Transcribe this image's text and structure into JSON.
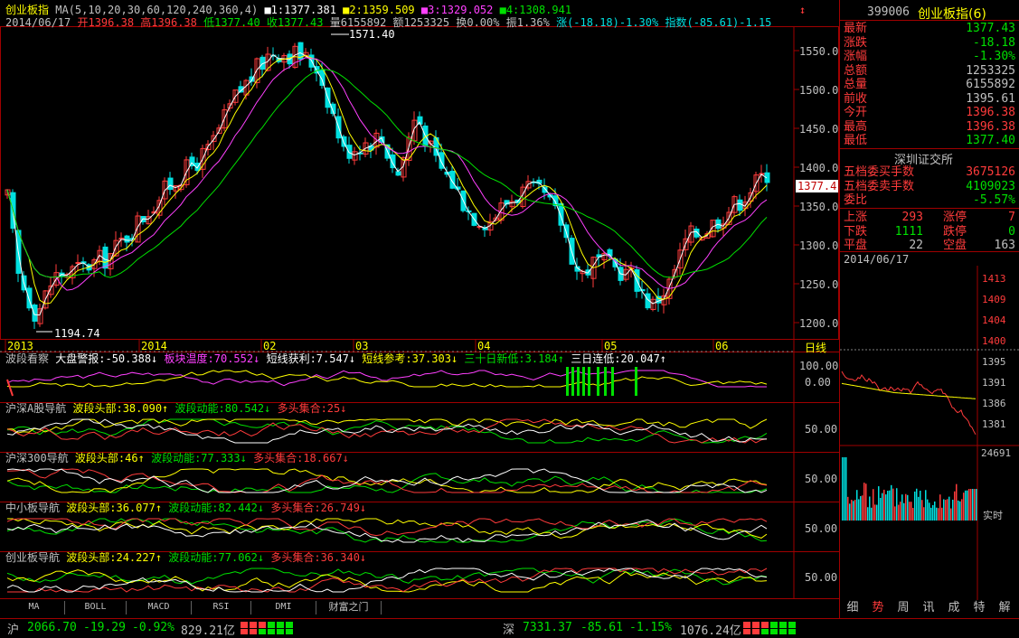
{
  "chart_header": {
    "name": "创业板指",
    "ma_label": "MA(5,10,20,30,60,120,240,360,4)",
    "ma_values": [
      {
        "label": "■1:1377.381",
        "color": "#ffffff"
      },
      {
        "label": "■2:1359.509",
        "color": "#ffff00"
      },
      {
        "label": "■3:1329.052",
        "color": "#ff40ff"
      },
      {
        "label": "■4:1308.941",
        "color": "#00e000"
      }
    ]
  },
  "day_info": {
    "date": "2014/06/17",
    "open": "开1396.38",
    "high": "高1396.38",
    "low": "低1377.40",
    "close": "收1377.43",
    "volume": "量6155892",
    "amount": "额1253325",
    "turnover": "换0.00%",
    "amplitude": "振1.36%",
    "change": "涨(-18.18)-1.30%",
    "index": "指数(-85.61)-1.15"
  },
  "price_axis": {
    "ticks": [
      "1550.0",
      "1500.0",
      "1450.0",
      "1400.0",
      "1350.0",
      "1300.0",
      "1250.0",
      "1200.0"
    ],
    "current_tag": "1377.4",
    "max_label": "1571.40",
    "min_label": "1194.74"
  },
  "time_axis": {
    "labels": [
      "2013",
      "2014",
      "02",
      "03",
      "04",
      "05",
      "06"
    ],
    "period": "日线"
  },
  "indicators": [
    {
      "name": "波段看察",
      "items": [
        {
          "text": "大盘警报:-50.388↓",
          "color": "#ffffff"
        },
        {
          "text": "板块温度:70.552↓",
          "color": "#ff40ff"
        },
        {
          "text": "短线获利:7.547↓",
          "color": "#ffffff"
        },
        {
          "text": "短线参考:37.303↓",
          "color": "#ffff00"
        },
        {
          "text": "三十日新低:3.184↑",
          "color": "#00e000"
        },
        {
          "text": "三日连低:20.047↑",
          "color": "#ffffff"
        }
      ],
      "axis": [
        "100.00",
        "0.00"
      ]
    },
    {
      "name": "沪深A股导航",
      "items": [
        {
          "text": "波段头部:38.090↑",
          "color": "#ffff00"
        },
        {
          "text": "波段动能:80.542↓",
          "color": "#00e000"
        },
        {
          "text": "多头集合:25↓",
          "color": "#ff3b3b"
        }
      ],
      "axis": [
        "50.00"
      ]
    },
    {
      "name": "沪深300导航",
      "items": [
        {
          "text": "波段头部:46↑",
          "color": "#ffff00"
        },
        {
          "text": "波段动能:77.333↓",
          "color": "#00e000"
        },
        {
          "text": "多头集合:18.667↓",
          "color": "#ff3b3b"
        }
      ],
      "axis": [
        "50.00"
      ]
    },
    {
      "name": "中小板导航",
      "items": [
        {
          "text": "波段头部:36.077↑",
          "color": "#ffff00"
        },
        {
          "text": "波段动能:82.442↓",
          "color": "#00e000"
        },
        {
          "text": "多头集合:26.749↓",
          "color": "#ff3b3b"
        }
      ],
      "axis": [
        "50.00"
      ]
    },
    {
      "name": "创业板导航",
      "items": [
        {
          "text": "波段头部:24.227↑",
          "color": "#ffff00"
        },
        {
          "text": "波段动能:77.062↓",
          "color": "#00e000"
        },
        {
          "text": "多头集合:36.340↓",
          "color": "#ff3b3b"
        }
      ],
      "axis": [
        "50.00"
      ]
    }
  ],
  "bottom_tabs": [
    "MA",
    "BOLL",
    "MACD",
    "RSI",
    "DMI",
    "财富之门"
  ],
  "quote": {
    "code": "399006",
    "name": "创业板指(6)",
    "rows": [
      {
        "k": "最新",
        "v": "1377.43",
        "color": "#00e000"
      },
      {
        "k": "涨跌",
        "v": "-18.18",
        "color": "#00e000"
      },
      {
        "k": "涨幅",
        "v": "-1.30%",
        "color": "#00e000"
      },
      {
        "k": "总额",
        "v": "1253325",
        "color": "#c0c0c0"
      },
      {
        "k": "总量",
        "v": "6155892",
        "color": "#c0c0c0"
      },
      {
        "k": "前收",
        "v": "1395.61",
        "color": "#c0c0c0"
      },
      {
        "k": "今开",
        "v": "1396.38",
        "color": "#ff3b3b"
      },
      {
        "k": "最高",
        "v": "1396.38",
        "color": "#ff3b3b"
      },
      {
        "k": "最低",
        "v": "1377.40",
        "color": "#00e000"
      }
    ],
    "exchange": "深圳证交所",
    "orders": [
      {
        "k": "五档委买手数",
        "v": "3675126",
        "color": "#ff3b3b"
      },
      {
        "k": "五档委卖手数",
        "v": "4109023",
        "color": "#00e000"
      },
      {
        "k": "委比",
        "v": "-5.57%",
        "color": "#00e000"
      }
    ],
    "breadth": [
      {
        "k": "上涨",
        "v": "293",
        "k2": "涨停",
        "v2": "7",
        "color": "#ff3b3b"
      },
      {
        "k": "下跌",
        "v": "1111",
        "k2": "跌停",
        "v2": "0",
        "color": "#00e000"
      },
      {
        "k": "平盘",
        "v": "22",
        "k2": "空盘",
        "v2": "163",
        "color": "#c0c0c0"
      }
    ],
    "mini_date": "2014/06/17",
    "mini_axis_red": [
      "1413",
      "1409",
      "1404",
      "1400"
    ],
    "mini_axis_gray": [
      "1395",
      "1391",
      "1386",
      "1381"
    ],
    "mini_vol": "24691",
    "mini_live": "实时",
    "right_tabs": [
      "细",
      "势",
      "周",
      "讯",
      "成",
      "特",
      "解"
    ]
  },
  "status_bar": {
    "sh_label": "沪",
    "sh_price": "2066.70",
    "sh_change": "-19.29",
    "sh_pct": "-0.92%",
    "sh_amount": "829.21亿",
    "sz_label": "深",
    "sz_price": "7331.37",
    "sz_change": "-85.61",
    "sz_pct": "-1.15%",
    "sz_amount": "1076.24亿"
  },
  "colors": {
    "frame": "#a00000",
    "up": "#ff3b3b",
    "down": "#00e0e0",
    "ma1": "#ffffff",
    "ma2": "#ffff00",
    "ma3": "#ff40ff",
    "ma4": "#00e000"
  }
}
